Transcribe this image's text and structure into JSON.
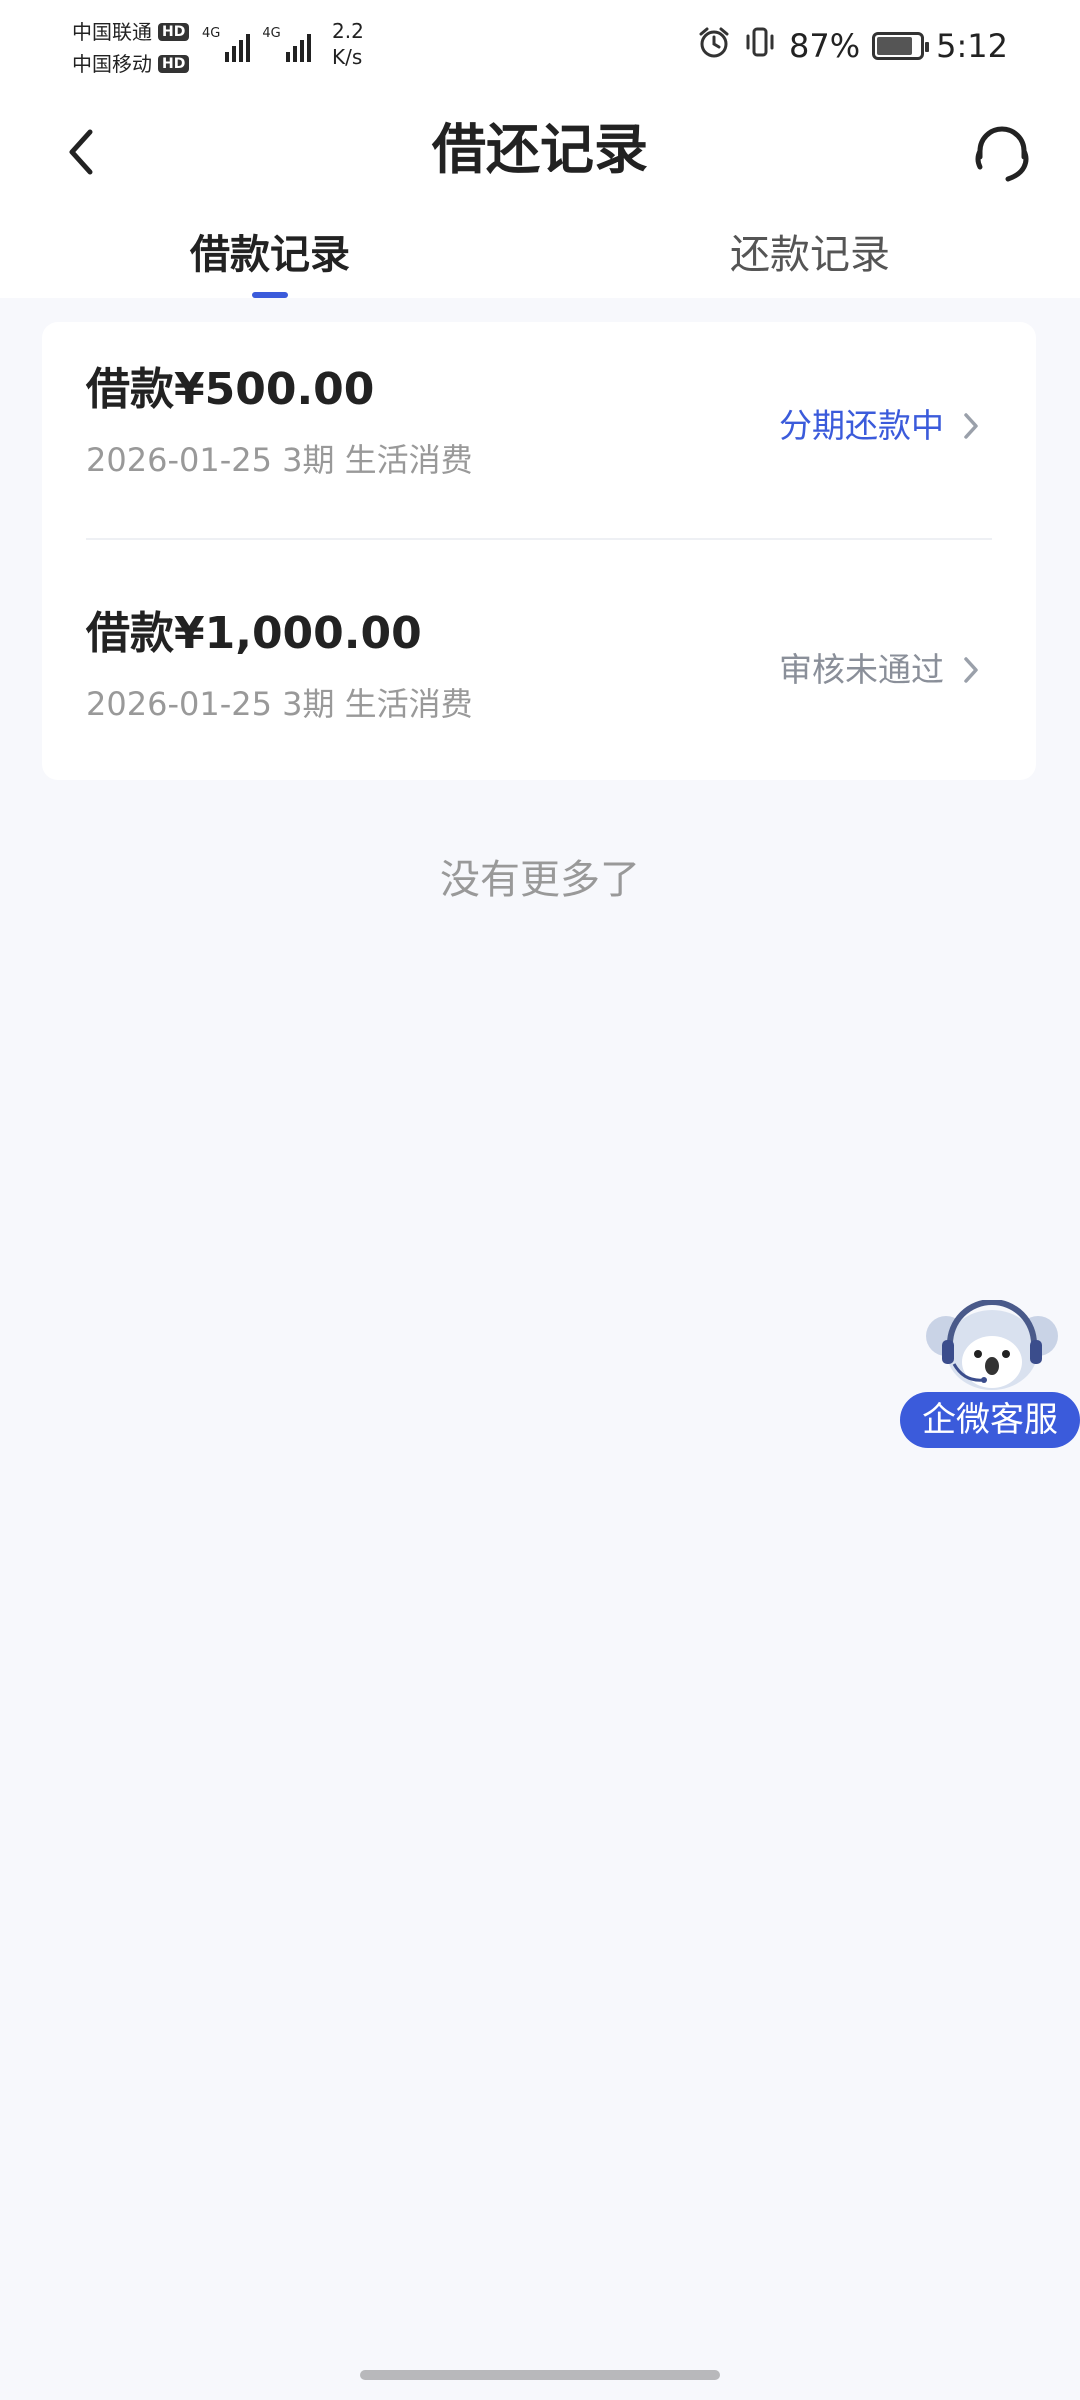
{
  "status_bar": {
    "carrier1": "中国联通",
    "carrier2": "中国移动",
    "hd": "HD",
    "net1": "4G",
    "net2": "4G",
    "speed_value": "2.2",
    "speed_unit": "K/s",
    "battery_percent": "87%",
    "battery_level": 0.87,
    "time": "5:12"
  },
  "nav": {
    "title": "借还记录",
    "back_icon": "chevron-left-icon",
    "service_icon": "headset-icon"
  },
  "tabs": [
    {
      "label": "借款记录",
      "active": true
    },
    {
      "label": "还款记录",
      "active": false
    }
  ],
  "records": [
    {
      "amount": "借款¥500.00",
      "meta": "2026-01-25 3期  生活消费",
      "status": "分期还款中",
      "status_color": "#3b5bdb"
    },
    {
      "amount": "借款¥1,000.00",
      "meta": "2026-01-25 3期  生活消费",
      "status": "审核未通过",
      "status_color": "#8a8f99"
    }
  ],
  "footer_text": "没有更多了",
  "float_service": {
    "label": "企微客服",
    "icon": "koala-mascot-icon"
  },
  "colors": {
    "accent": "#3b5bdb",
    "background": "#f7f8fc"
  }
}
